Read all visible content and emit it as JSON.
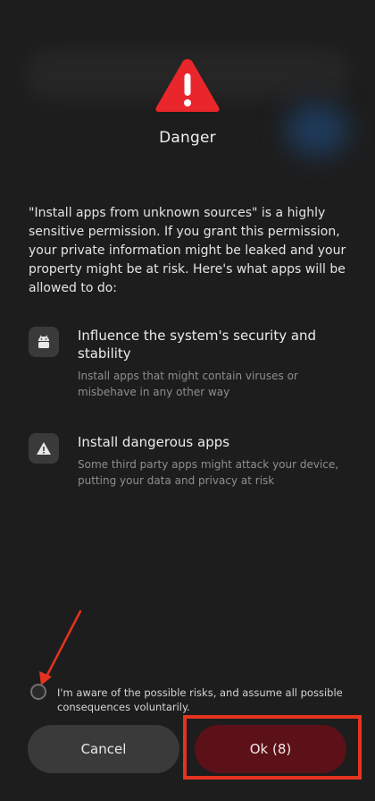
{
  "dialog": {
    "title": "Danger",
    "description": "\"Install apps from unknown sources\" is a highly sensitive permission. If you grant this permission, your private information might be leaked and your property might be at risk. Here's what apps will be allowed to do:",
    "permissions": [
      {
        "icon": "android-icon",
        "title": "Influence the system's security and stability",
        "description": "Install apps that might contain viruses or misbehave in any other way"
      },
      {
        "icon": "warning-icon",
        "title": "Install dangerous apps",
        "description": "Some third party apps might attack your device, putting your data and privacy at risk"
      }
    ],
    "consent_text": "I'm aware of the possible risks, and assume all possible consequences voluntarily.",
    "consent_checked": false,
    "cancel_label": "Cancel",
    "ok_label": "Ok (8)"
  },
  "colors": {
    "background": "#1d1d1d",
    "danger_red": "#e8262b",
    "ok_button": "#5c1018",
    "cancel_button": "#3a3a3a",
    "annotation_red": "#e4331f"
  }
}
